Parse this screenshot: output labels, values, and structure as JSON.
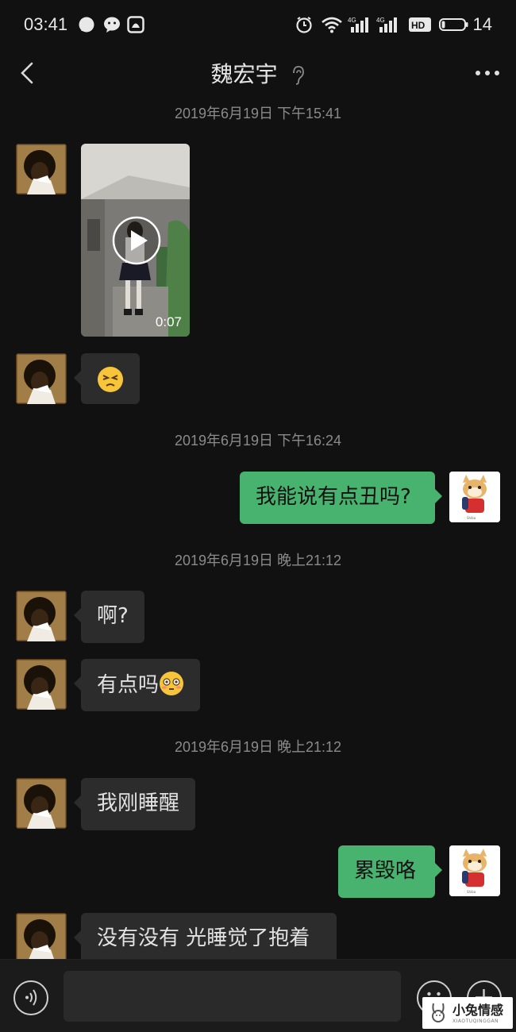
{
  "status_bar": {
    "time": "03:41",
    "battery": "14",
    "icons": [
      "message-bubble-icon",
      "wechat-icon",
      "snapchat-icon",
      "alarm-icon",
      "wifi-icon",
      "signal-4g-icon",
      "signal-4g-icon",
      "hd-icon",
      "battery-icon"
    ]
  },
  "nav": {
    "title": "魏宏宇",
    "icons": [
      "back-icon",
      "ear-icon",
      "more-icon"
    ]
  },
  "messages": {
    "ts1": "2019年6月19日 下午15:41",
    "video_duration": "0:07",
    "ts2": "2019年6月19日 下午16:24",
    "m_self_1": "我能说有点丑吗?",
    "ts3": "2019年6月19日 晚上21:12",
    "m_other_1": "啊?",
    "m_other_2": "有点吗",
    "ts4": "2019年6月19日 晚上21:12",
    "m_other_3": "我刚睡醒",
    "m_self_2": "累毁咯",
    "m_other_4": "没有没有 光睡觉了抱着"
  },
  "input_bar": {
    "icons": [
      "voice-icon",
      "emoji-icon",
      "plus-icon"
    ]
  },
  "watermark": {
    "title": "小兔情感",
    "subtitle": "XIAOTUQINGGAN"
  },
  "colors": {
    "background": "#111111",
    "bubble_self": "#48b36f",
    "bubble_other": "#2c2c2c",
    "timestamp": "#8a8a8a"
  }
}
